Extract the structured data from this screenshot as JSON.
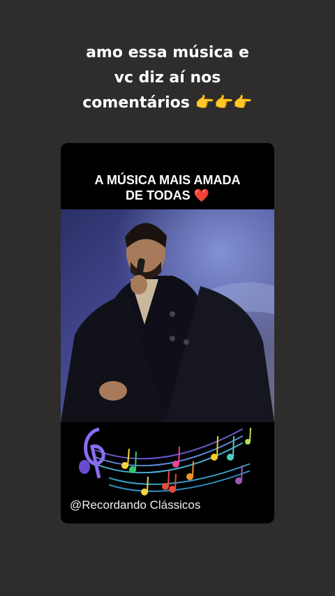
{
  "overlay_caption": {
    "lines": [
      "amo essa música e",
      "vc diz aí nos",
      "comentários 👉👉👉"
    ]
  },
  "card": {
    "title_line1": "A MÚSICA MAIS AMADA",
    "title_line2": "DE TODAS",
    "title_emoji": "❤️",
    "watermark": "@Recordando Clássicos"
  },
  "icons": {
    "pointing": "pointing-right-emoji",
    "heart": "red-heart-emoji",
    "decor": "colorful-music-notes-staff"
  },
  "colors": {
    "page_bg": "#2e2d2c",
    "card_bg": "#000000",
    "stage_bg": "#3a3f7a"
  }
}
